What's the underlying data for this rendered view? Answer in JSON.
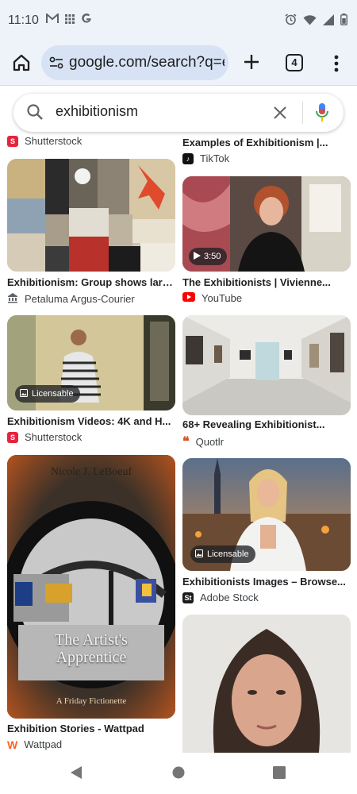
{
  "status": {
    "time": "11:10"
  },
  "browser": {
    "url": "google.com/search?q=e",
    "tab_count": "4"
  },
  "search": {
    "query": "exhibitionism"
  },
  "results": [
    {
      "source": "Shutterstock",
      "source_color": "#e8223d"
    },
    {
      "title": "Examples of Exhibitionism |...",
      "source": "TikTok",
      "source_color": "#111111"
    },
    {
      "title": "Exhibitionism: Group shows larg...",
      "source": "Petaluma Argus-Courier",
      "source_color": "#5f6368"
    },
    {
      "title": "The Exhibitionists | Vivienne...",
      "source": "YouTube",
      "source_color": "#ff0000",
      "duration": "3:50"
    },
    {
      "title": "Exhibitionism Videos: 4K and H...",
      "source": "Shutterstock",
      "source_color": "#e8223d",
      "badge": "Licensable"
    },
    {
      "title": "68+ Revealing Exhibitionist...",
      "source": "Quotlr",
      "source_color": "#d9552c"
    },
    {
      "title": "Exhibition Stories - Wattpad",
      "source": "Wattpad",
      "source_color": "#ff6122",
      "book_author": "Nicole J. LeBoeuf",
      "book_title_1": "The Artist's",
      "book_title_2": "Apprentice",
      "book_subtitle": "A Friday Fictionette"
    },
    {
      "title": "Exhibitionists Images – Browse...",
      "source": "Adobe Stock",
      "source_color": "#1b1b1b",
      "badge": "Licensable"
    },
    {
      "title": "",
      "source": ""
    }
  ]
}
